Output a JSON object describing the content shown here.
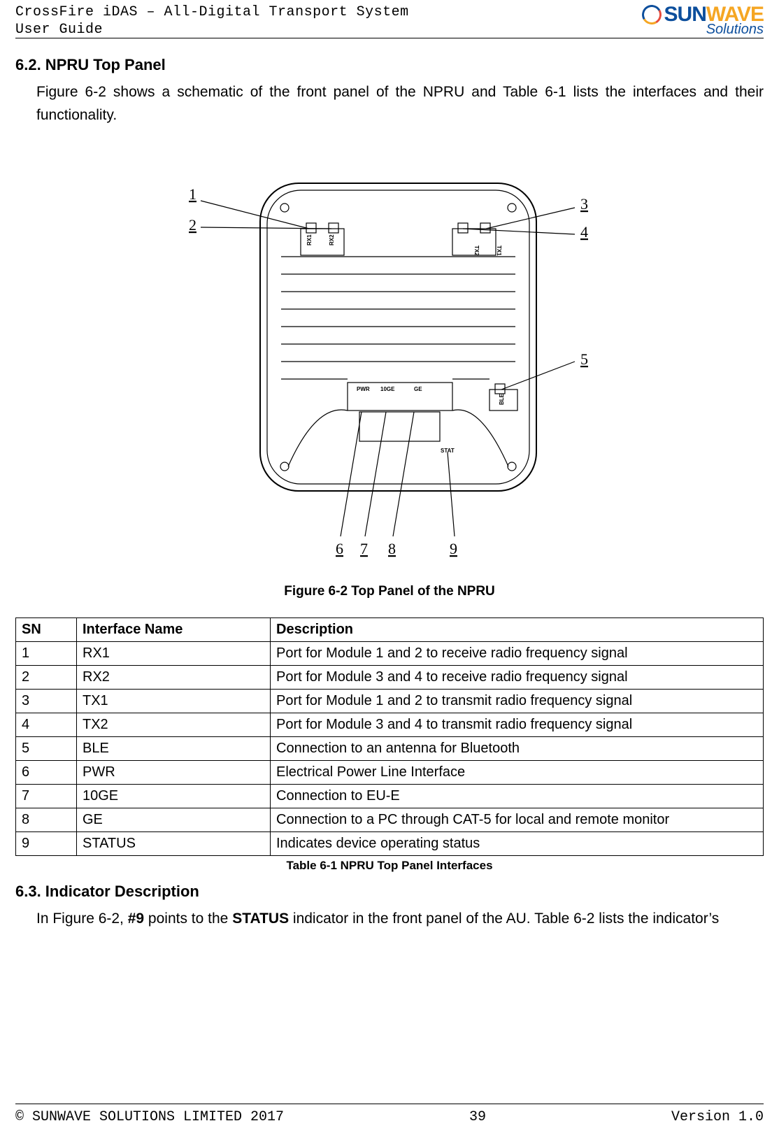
{
  "header": {
    "line1": "CrossFire iDAS – All-Digital Transport System",
    "line2": "User Guide",
    "logo_main_a": "SUN",
    "logo_main_b": "WAVE",
    "logo_sub": "Solutions"
  },
  "sections": {
    "s62": {
      "heading": "6.2. NPRU Top Panel",
      "para": "Figure 6-2 shows a schematic of the front panel of the NPRU and Table 6-1 lists the interfaces and their functionality."
    },
    "figure": {
      "caption": "Figure 6-2 Top Panel of the NPRU",
      "callouts": {
        "c1": "1",
        "c2": "2",
        "c3": "3",
        "c4": "4",
        "c5": "5",
        "c6": "6",
        "c7": "7",
        "c8": "8",
        "c9": "9"
      },
      "device_labels": {
        "rx1": "RX1",
        "rx2": "RX2",
        "tx1": "TX1",
        "tx2": "TX2",
        "ble": "BLE",
        "pwr": "PWR",
        "tenge": "10GE",
        "ge": "GE",
        "stat": "STAT"
      }
    },
    "table": {
      "headers": {
        "sn": "SN",
        "name": "Interface Name",
        "desc": "Description"
      },
      "rows": [
        {
          "sn": "1",
          "name": "RX1",
          "desc": "Port for Module 1 and 2 to receive radio frequency signal"
        },
        {
          "sn": "2",
          "name": "RX2",
          "desc": "Port for Module 3 and 4 to receive radio frequency signal"
        },
        {
          "sn": "3",
          "name": "TX1",
          "desc": "Port for Module 1 and 2 to transmit radio frequency signal"
        },
        {
          "sn": "4",
          "name": "TX2",
          "desc": "Port for Module 3 and 4 to transmit radio frequency signal"
        },
        {
          "sn": "5",
          "name": "BLE",
          "desc": "Connection to an antenna for Bluetooth"
        },
        {
          "sn": "6",
          "name": "PWR",
          "desc": "Electrical Power Line Interface"
        },
        {
          "sn": "7",
          "name": "10GE",
          "desc": "Connection to EU-E"
        },
        {
          "sn": "8",
          "name": "GE",
          "desc": "Connection to a PC through CAT-5 for local and remote monitor"
        },
        {
          "sn": "9",
          "name": "STATUS",
          "desc": "Indicates device operating status"
        }
      ],
      "caption": "Table 6-1 NPRU Top Panel Interfaces"
    },
    "s63": {
      "heading": "6.3. Indicator Description",
      "para_pre": "In Figure 6-2, ",
      "para_bold1": "#9",
      "para_mid": " points to the ",
      "para_bold2": "STATUS",
      "para_post": " indicator in the front panel of the AU. Table 6-2 lists the indicator’s"
    }
  },
  "footer": {
    "left": "© SUNWAVE SOLUTIONS LIMITED 2017",
    "center": "39",
    "right": "Version 1.0"
  }
}
